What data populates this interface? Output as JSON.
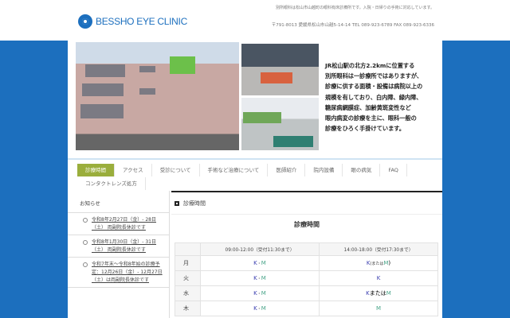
{
  "header": {
    "logo": "BESSHO EYE CLINIC",
    "tagline": "別所眼科は松山市山越町の眼科有床診療所です。入院・日帰りの手術に対応しています。",
    "address": "〒791-8013 愛媛県松山市山越5-14-14 TEL 089-923-6789 FAX 089-923-6336"
  },
  "intro": [
    "JR松山駅の北方2.2kmに位置する",
    "別所眼科は一診療所ではありますが、",
    "診療に供する面積・設備は病院以上の",
    "規模を有しており、白内障、緑内障、",
    "糖尿病網膜症、加齢黄斑変性など",
    "眼内病変の診療を主に、眼科一般の",
    "診療をひろく手掛けています。"
  ],
  "nav": [
    "診療時間",
    "アクセス",
    "受診について",
    "手術など治療について",
    "医師紹介",
    "院内設備",
    "眼の病気",
    "FAQ",
    "コンタクトレンズ処方"
  ],
  "sidebar": {
    "title": "お知らせ",
    "news": [
      "令和8年2月27日（金）- 28日（土） 両副院長休診です",
      "令和8年1月30日（金）- 31日（土） 両副院長休診です",
      "令和7年末～令和8年始の診療予定：12月26日（金）- 12月27日（土）は両副院長休診です"
    ]
  },
  "main": {
    "section": "診療時間",
    "table_title": "診療時間",
    "headers": [
      "",
      "09:00-12:00（受付11:30まで）",
      "14:00-18:00（受付17:30まで）"
    ],
    "rows": [
      {
        "day": "月",
        "am": [
          "K",
          "・",
          "M"
        ],
        "pm": [
          "K",
          "(または",
          "M",
          ")"
        ]
      },
      {
        "day": "火",
        "am": [
          "K",
          "・",
          "M"
        ],
        "pm": [
          "K"
        ]
      },
      {
        "day": "水",
        "am": [
          "K",
          "・",
          "M"
        ],
        "pm": [
          "K",
          "または",
          "M"
        ]
      },
      {
        "day": "木",
        "am": [
          "K",
          "・",
          "M"
        ],
        "pm": [
          "M"
        ]
      }
    ]
  },
  "colors": {
    "brand": "#1c6fbe",
    "nav_active": "#9aae3c",
    "k": "#3b3fb0",
    "m": "#4aa58a"
  }
}
